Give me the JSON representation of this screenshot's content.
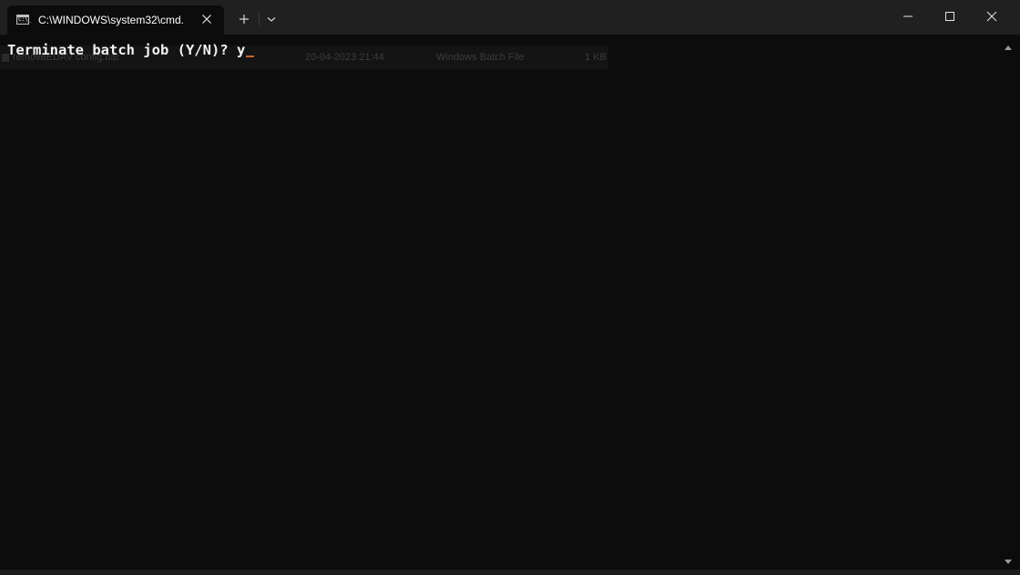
{
  "tab": {
    "title": "C:\\WINDOWS\\system32\\cmd.",
    "icon": "cmd-prompt-icon",
    "icon_prompt": "C:\\_"
  },
  "titlebar": {
    "new_tab_icon": "plus-icon",
    "dropdown_icon": "chevron-down-icon",
    "minimize_icon": "minimize-icon",
    "maximize_icon": "maximize-icon",
    "close_icon": "close-icon"
  },
  "terminal": {
    "prompt_text": "Terminate batch job (Y/N)? ",
    "input_text": "y",
    "cursor_color": "#c0642a"
  },
  "ghost_row": {
    "name": "removeEDAV config.bat",
    "date": "20-04-2023 21:44",
    "type": "Windows Batch File",
    "size": "1 KB"
  },
  "colors": {
    "titlebar": "#202020",
    "terminal_bg": "#0c0c0c",
    "text": "#f2f2f2"
  }
}
